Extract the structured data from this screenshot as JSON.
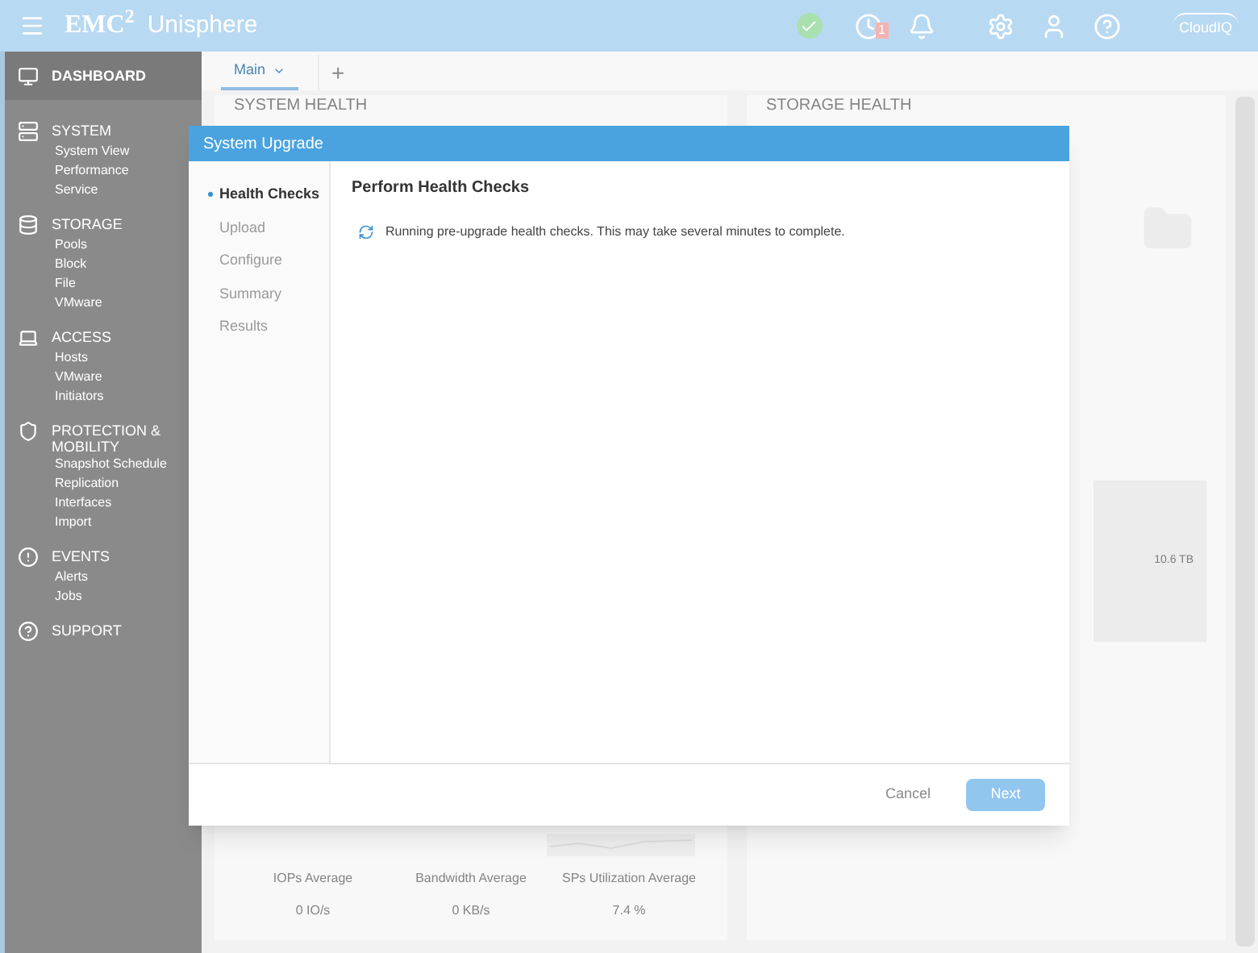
{
  "header": {
    "logo": "EMC$^{2}$",
    "app_name": "Unisphere",
    "alert_badge": "1",
    "cloudiq": "CloudIQ"
  },
  "sidebar": [
    {
      "label": "DASHBOARD",
      "selected": true
    },
    {
      "label": "SYSTEM",
      "selected": false,
      "items": [
        "System View",
        "Performance",
        "Service"
      ]
    },
    {
      "label": "STORAGE",
      "selected": false,
      "items": [
        "Pools",
        "Block",
        "File",
        "VMware"
      ]
    },
    {
      "label": "ACCESS",
      "selected": false,
      "items": [
        "Hosts",
        "VMware",
        "Initiators"
      ]
    },
    {
      "label": "PROTECTION & MOBILITY",
      "selected": false,
      "items": [
        "Snapshot Schedule",
        "Replication",
        "Interfaces",
        "Import"
      ]
    },
    {
      "label": "EVENTS",
      "selected": false,
      "items": [
        "Alerts",
        "Jobs"
      ]
    },
    {
      "label": "SUPPORT",
      "selected": false
    }
  ],
  "tabs": [
    {
      "label": "Main",
      "selected": true
    }
  ],
  "add_tab": "+",
  "dashboard": {
    "system_health": "SYSTEM HEALTH",
    "storage_health": "STORAGE HEALTH",
    "capacity": "10.6 TB",
    "stats": [
      {
        "label": "IOPs Average",
        "value": "0 IO/s"
      },
      {
        "label": "Bandwidth Average",
        "value": "0 KB/s"
      },
      {
        "label": "SPs Utilization Average",
        "value": "7.4 %"
      }
    ]
  },
  "dialog": {
    "title": "System Upgrade",
    "steps": [
      {
        "label": "Health Checks",
        "selected": true
      },
      {
        "label": "Upload",
        "selected": false
      },
      {
        "label": "Configure",
        "selected": false
      },
      {
        "label": "Summary",
        "selected": false
      },
      {
        "label": "Results",
        "selected": false
      }
    ],
    "heading": "Perform Health Checks",
    "message": "Running pre-upgrade health checks. This may take several minutes to complete.",
    "cancel": {
      "label": "Cancel"
    },
    "next": {
      "label": "Next",
      "disabled": true
    }
  }
}
